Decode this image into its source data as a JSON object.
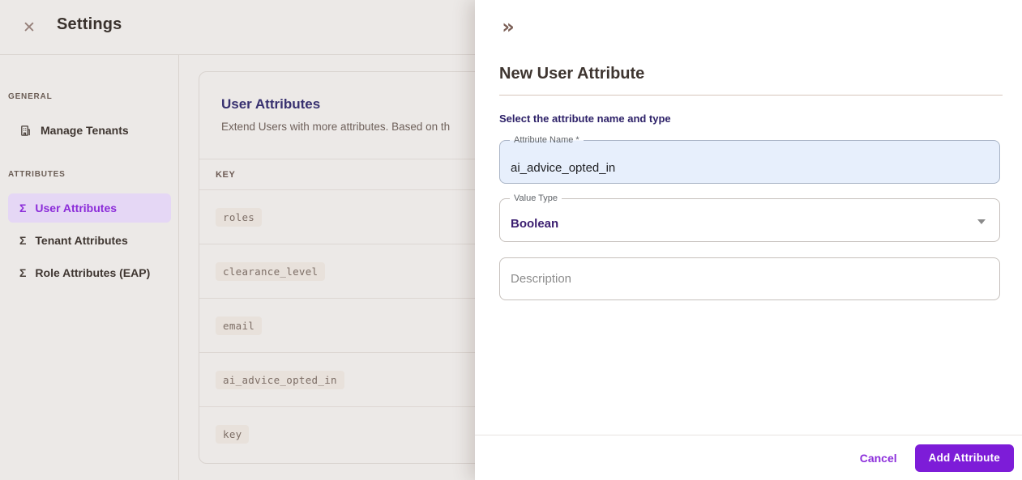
{
  "header": {
    "title": "Settings",
    "close_icon": "✕"
  },
  "sidebar": {
    "sections": [
      {
        "label": "GENERAL",
        "items": [
          {
            "label": "Manage Tenants",
            "icon": "building-icon",
            "selected": false
          }
        ]
      },
      {
        "label": "ATTRIBUTES",
        "items": [
          {
            "label": "User Attributes",
            "icon": "sigma-icon",
            "selected": true
          },
          {
            "label": "Tenant Attributes",
            "icon": "sigma-icon",
            "selected": false
          },
          {
            "label": "Role Attributes (EAP)",
            "icon": "sigma-icon",
            "selected": false
          }
        ]
      }
    ],
    "sigma_glyph": "Σ"
  },
  "main": {
    "card": {
      "title": "User Attributes",
      "subtitle": "Extend Users with more attributes. Based on th",
      "table": {
        "columns": [
          "KEY"
        ],
        "rows": [
          "roles",
          "clearance_level",
          "email",
          "ai_advice_opted_in",
          "key"
        ]
      }
    }
  },
  "drawer": {
    "collapse_icon": "»",
    "title": "New User Attribute",
    "instruction": "Select the attribute name and type",
    "fields": {
      "attribute_name": {
        "label": "Attribute Name *",
        "value": "ai_advice_opted_in"
      },
      "value_type": {
        "label": "Value Type",
        "value": "Boolean"
      },
      "description": {
        "label": "",
        "placeholder": "Description",
        "value": ""
      }
    },
    "footer": {
      "cancel_label": "Cancel",
      "submit_label": "Add Attribute"
    }
  },
  "colors": {
    "primary_purple": "#7d1cd8",
    "link_purple": "#8c2fdb",
    "selected_item_purple": "#8b2bd9",
    "selected_item_bg": "#e5d7f5",
    "heading_indigo": "#37306f",
    "instruction_indigo": "#2d2168",
    "value_indigo": "#3b1e70",
    "autofill_blue": "#e7effc",
    "page_bg": "#ece9e7",
    "drawer_bg": "#ffffff"
  }
}
